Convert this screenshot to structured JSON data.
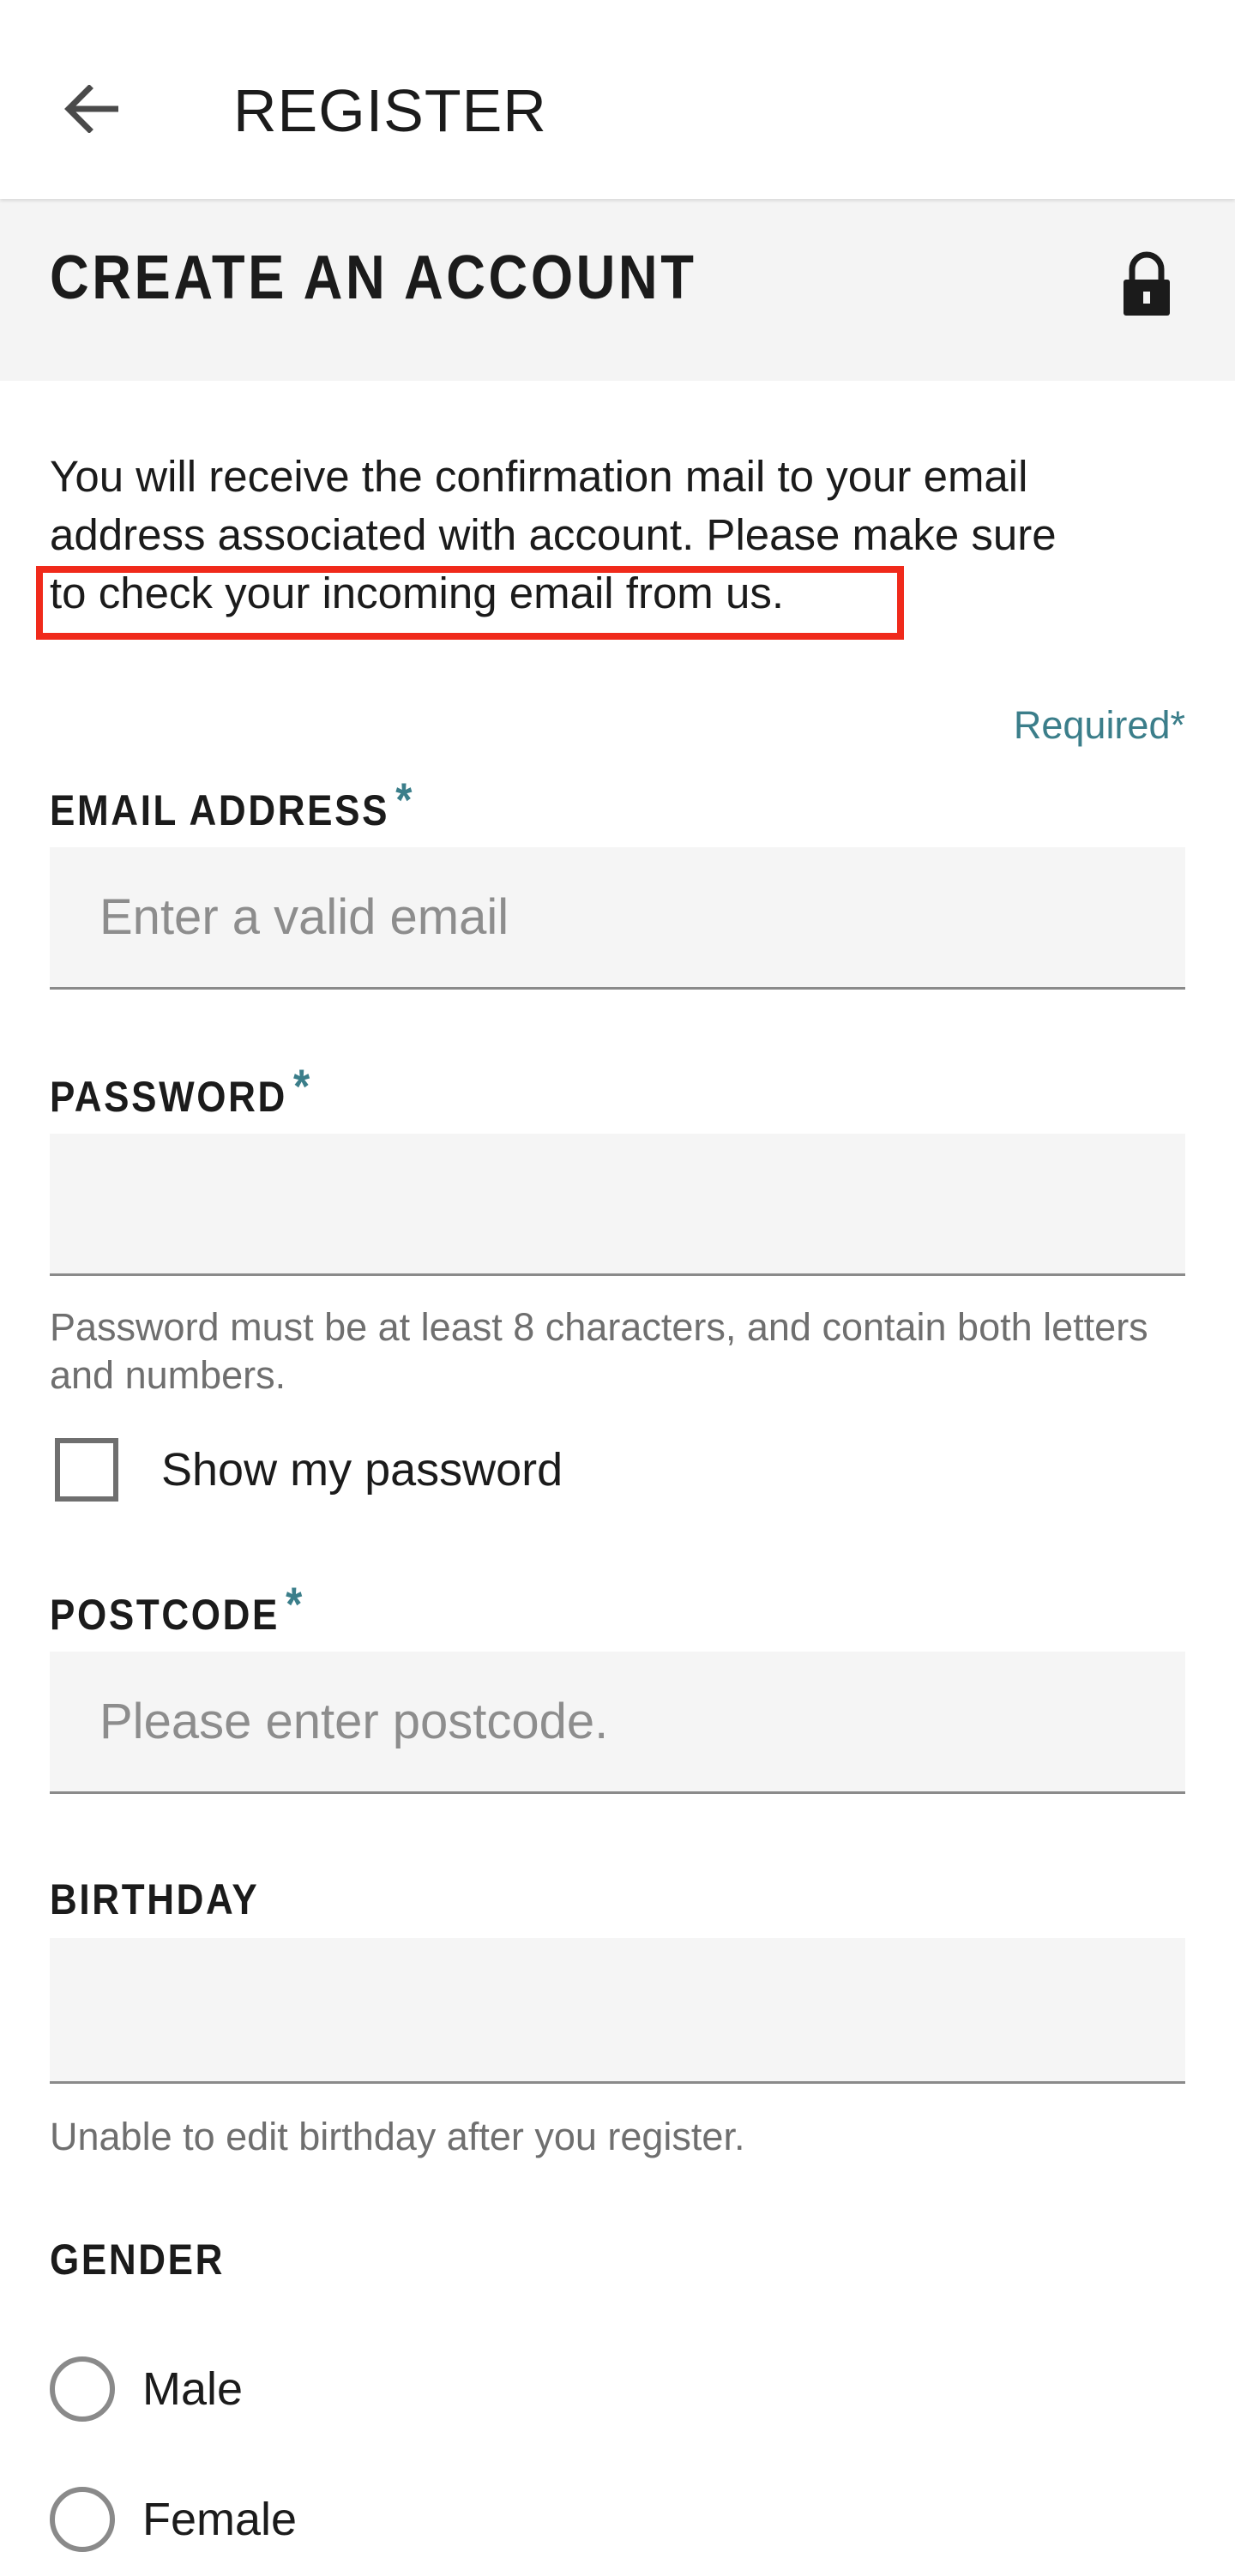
{
  "app_bar": {
    "title": "REGISTER",
    "back_icon": "arrow-left-icon"
  },
  "section": {
    "title": "CREATE AN ACCOUNT",
    "lock_icon": "lock-icon"
  },
  "notice": {
    "line1": "You will receive the confirmation mail to your email",
    "line2": "address associated with account. Please make sure",
    "line3": "to check your incoming email from us."
  },
  "required_note": "Required*",
  "fields": {
    "email": {
      "label": "EMAIL ADDRESS",
      "required_mark": "*",
      "value": "",
      "placeholder": "Enter a valid email"
    },
    "password": {
      "label": "PASSWORD",
      "required_mark": "*",
      "value": "",
      "placeholder": "",
      "hint": "Password must be at least 8 characters, and contain both letters and numbers.",
      "show_password_label": "Show my password",
      "show_password_checked": false
    },
    "postcode": {
      "label": "POSTCODE",
      "required_mark": "*",
      "value": "",
      "placeholder": "Please enter postcode."
    },
    "birthday": {
      "label": "BIRTHDAY",
      "value": "",
      "hint": "Unable to edit birthday after you register."
    },
    "gender": {
      "label": "GENDER",
      "options": [
        "Male",
        "Female"
      ]
    }
  },
  "colors": {
    "accent_teal": "#3b7e8a",
    "highlight_red": "#f02a1b",
    "input_background": "#f5f5f5",
    "section_background": "#f4f4f4"
  }
}
